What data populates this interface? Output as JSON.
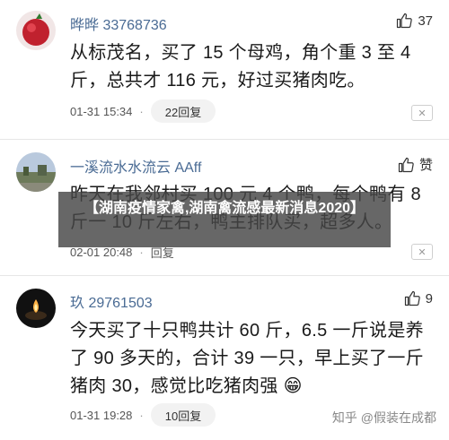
{
  "comments": [
    {
      "username": "晔晔 33768736",
      "like_count": "37",
      "text": "从标茂名，买了 15 个母鸡，角个重 3 至 4 斤，总共才 116 元，好过买猪肉吃。",
      "time": "01-31 15:34",
      "reply": "22回复"
    },
    {
      "username": "一溪流水水流云 AAff",
      "like_count": "赞",
      "text": "昨天在我邻村买 100 元 4 个鸭，每个鸭有 8 斤一 10 斤左右，鸭主排队买，超多人。",
      "time": "02-01 20:48",
      "reply": "回复"
    },
    {
      "username": "玖 29761503",
      "like_count": "9",
      "text": "今天买了十只鸭共计 60 斤，6.5 一斤说是养了 90 多天的，合计 39 一只，早上买了一斤猪肉 30，感觉比吃猪肉强",
      "time": "01-31 19:28",
      "reply": "10回复"
    }
  ],
  "banner": "【湖南疫情家禽,湖南禽流感最新消息2020】",
  "watermark": "知乎 @假装在成都",
  "close_symbol": "✕",
  "dot": "·",
  "emoji": "😁"
}
